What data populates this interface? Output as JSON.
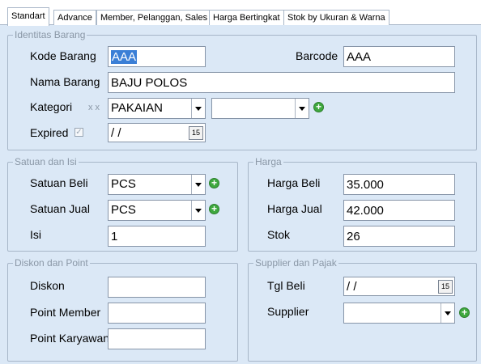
{
  "tabs": [
    {
      "label": "Standart"
    },
    {
      "label": "Advance"
    },
    {
      "label": "Member, Pelanggan, Sales"
    },
    {
      "label": "Harga Bertingkat"
    },
    {
      "label": "Stok by Ukuran & Warna"
    }
  ],
  "identitas": {
    "title": "Identitas Barang",
    "kode_label": "Kode Barang",
    "kode_value": "AAA",
    "barcode_label": "Barcode",
    "barcode_value": "AAA",
    "nama_label": "Nama Barang",
    "nama_value": "BAJU POLOS",
    "kategori_label": "Kategori",
    "kategori_marks": "x x",
    "kategori_value": "PAKAIAN",
    "subkategori_value": "",
    "expired_label": "Expired",
    "expired_value": " /  /",
    "expired_checked": true
  },
  "satuan": {
    "title": "Satuan dan Isi",
    "beli_label": "Satuan Beli",
    "beli_value": "PCS",
    "jual_label": "Satuan Jual",
    "jual_value": "PCS",
    "isi_label": "Isi",
    "isi_value": "1"
  },
  "harga": {
    "title": "Harga",
    "beli_label": "Harga Beli",
    "beli_value": "35.000",
    "jual_label": "Harga Jual",
    "jual_value": "42.000",
    "stok_label": "Stok",
    "stok_value": "26"
  },
  "diskon": {
    "title": "Diskon dan Point",
    "diskon_label": "Diskon",
    "diskon_value": "",
    "member_label": "Point Member",
    "member_value": "",
    "karyawan_label": "Point Karyawan",
    "karyawan_value": ""
  },
  "supplier": {
    "title": "Supplier dan Pajak",
    "tgl_label": "Tgl Beli",
    "tgl_value": " /  /",
    "supplier_label": "Supplier",
    "supplier_value": ""
  },
  "icons": {
    "add": "add-icon",
    "dropdown": "chevron-down-icon",
    "calendar": "calendar-icon",
    "calendar_glyph": "15",
    "plus_glyph": "+",
    "check_glyph": "✓"
  },
  "colors": {
    "panel": "#dbe8f6",
    "selection": "#3b7fd6",
    "add": "#3ea83e"
  }
}
